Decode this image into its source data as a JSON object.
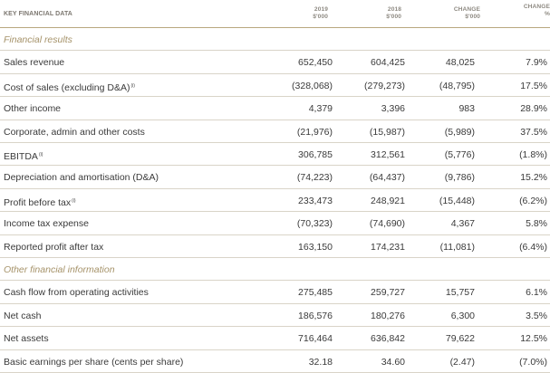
{
  "header": {
    "title": "KEY FINANCIAL DATA",
    "columns": [
      {
        "line1": "2019",
        "line2": "$'000"
      },
      {
        "line1": "2018",
        "line2": "$'000"
      },
      {
        "line1": "CHANGE",
        "line2": "$'000"
      },
      {
        "line1": "CHANGE",
        "line2": "%"
      }
    ]
  },
  "sections": [
    {
      "title": "Financial results",
      "rows": [
        {
          "label": "Sales revenue",
          "note": "",
          "v2019": "652,450",
          "v2018": "604,425",
          "change": "48,025",
          "pct": "7.9%"
        },
        {
          "label": "Cost of sales (excluding D&A)",
          "note": "(i)",
          "v2019": "(328,068)",
          "v2018": "(279,273)",
          "change": "(48,795)",
          "pct": "17.5%"
        },
        {
          "label": "Other income",
          "note": "",
          "v2019": "4,379",
          "v2018": "3,396",
          "change": "983",
          "pct": "28.9%"
        },
        {
          "label": "Corporate, admin and other costs",
          "note": "",
          "v2019": "(21,976)",
          "v2018": "(15,987)",
          "change": "(5,989)",
          "pct": "37.5%"
        },
        {
          "label": "EBITDA",
          "note": "(i)",
          "v2019": "306,785",
          "v2018": "312,561",
          "change": "(5,776)",
          "pct": "(1.8%)"
        },
        {
          "label": "Depreciation and amortisation (D&A)",
          "note": "",
          "v2019": "(74,223)",
          "v2018": "(64,437)",
          "change": "(9,786)",
          "pct": "15.2%"
        },
        {
          "label": "Profit before tax",
          "note": "(i)",
          "v2019": "233,473",
          "v2018": "248,921",
          "change": "(15,448)",
          "pct": "(6.2%)"
        },
        {
          "label": "Income tax expense",
          "note": "",
          "v2019": "(70,323)",
          "v2018": "(74,690)",
          "change": "4,367",
          "pct": "5.8%"
        },
        {
          "label": "Reported profit after tax",
          "note": "",
          "v2019": "163,150",
          "v2018": "174,231",
          "change": "(11,081)",
          "pct": "(6.4%)"
        }
      ]
    },
    {
      "title": "Other financial information",
      "rows": [
        {
          "label": "Cash flow from operating activities",
          "note": "",
          "v2019": "275,485",
          "v2018": "259,727",
          "change": "15,757",
          "pct": "6.1%"
        },
        {
          "label": "Net cash",
          "note": "",
          "v2019": "186,576",
          "v2018": "180,276",
          "change": "6,300",
          "pct": "3.5%"
        },
        {
          "label": "Net assets",
          "note": "",
          "v2019": "716,464",
          "v2018": "636,842",
          "change": "79,622",
          "pct": "12.5%"
        },
        {
          "label": "Basic earnings per share (cents per share)",
          "note": "",
          "v2019": "32.18",
          "v2018": "34.60",
          "change": "(2.47)",
          "pct": "(7.0%)"
        }
      ]
    }
  ]
}
